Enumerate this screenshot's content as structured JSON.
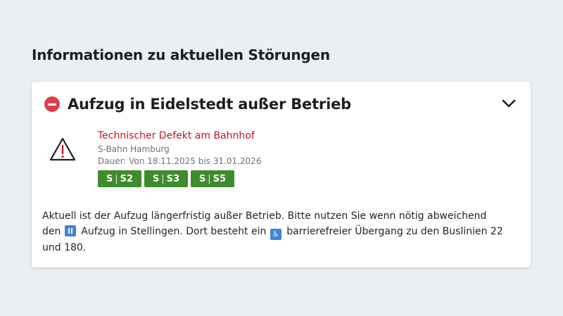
{
  "section": {
    "title": "Informationen zu aktuellen Störungen"
  },
  "card": {
    "title": "Aufzug in Eidelstedt außer Betrieb",
    "detail": {
      "title": "Technischer Defekt am Bahnhof",
      "operator": "S-Bahn Hamburg",
      "duration": "Dauer: Von 18.11.2025 bis 31.01.2026",
      "lines": [
        {
          "prefix": "S",
          "name": "S2"
        },
        {
          "prefix": "S",
          "name": "S3"
        },
        {
          "prefix": "S",
          "name": "S5"
        }
      ]
    },
    "description": {
      "part1": "Aktuell ist der Aufzug längerfristig außer Betrieb. Bitte nutzen Sie wenn nötig abweichend den ",
      "part2": " Aufzug in Stellingen. Dort besteht ein ",
      "part3": " barrierefreier Übergang zu den Buslinien 22 und 180."
    }
  },
  "icons": {
    "status": "no-entry-icon",
    "toggle": "chevron-down-icon",
    "warning": "warning-icon",
    "elevator": "elevator-icon",
    "wheelchair": "wheelchair-icon"
  },
  "colors": {
    "background": "#eceff2",
    "alert_red": "#d9404f",
    "detail_title_red": "#c8102e",
    "line_badge_green": "#3e8c2d",
    "info_icon_blue": "#3f84d6"
  }
}
